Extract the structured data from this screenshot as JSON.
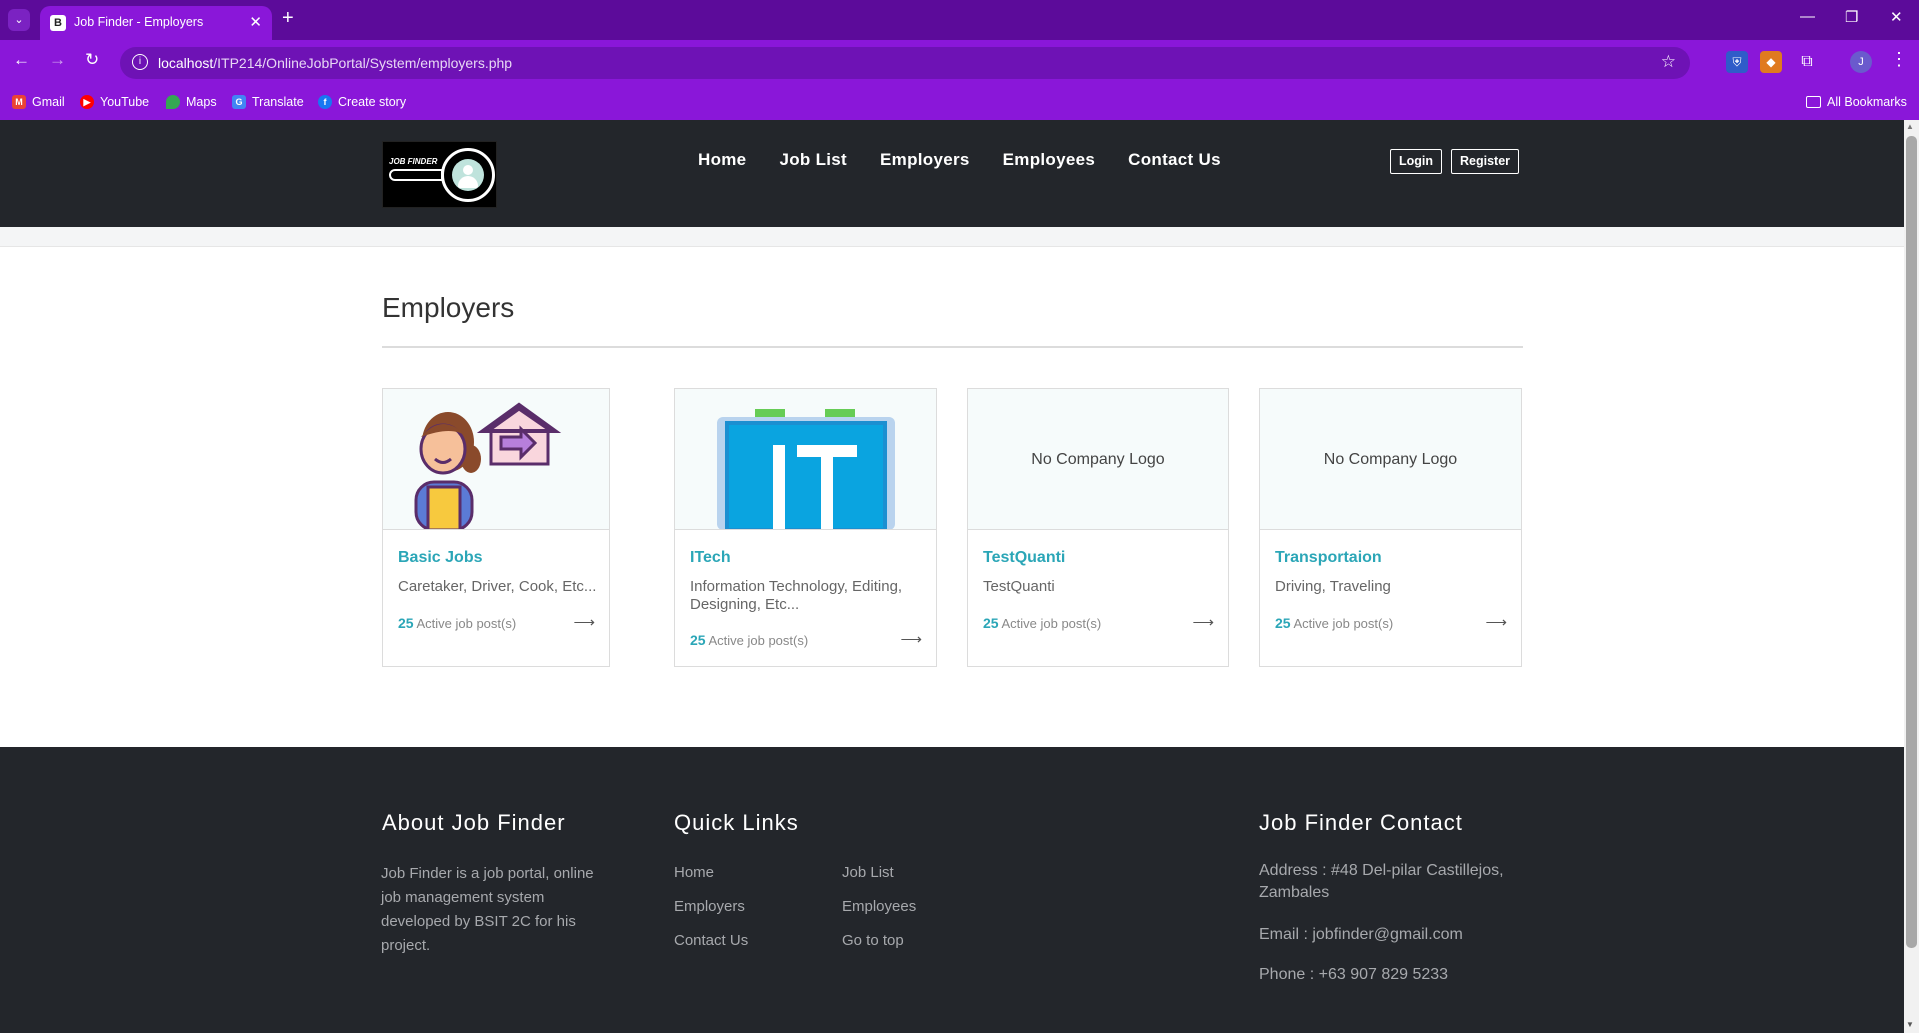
{
  "browser": {
    "tab_title": "Job Finder - Employers",
    "tab_favicon": "B",
    "url_host": "localhost",
    "url_path": "/ITP214/OnlineJobPortal/System/employers.php",
    "profile_initial": "J",
    "bookmarks": [
      "Gmail",
      "YouTube",
      "Maps",
      "Translate",
      "Create story"
    ],
    "all_bookmarks": "All Bookmarks"
  },
  "header": {
    "logo_text": "JOB FINDER",
    "nav": [
      "Home",
      "Job List",
      "Employers",
      "Employees",
      "Contact Us"
    ],
    "login": "Login",
    "register": "Register"
  },
  "page": {
    "title": "Employers"
  },
  "employers": [
    {
      "name": "Basic Jobs",
      "tags": "Caretaker, Driver, Cook, Etc...",
      "count": "25",
      "count_label": "Active job post(s)",
      "logo": "basic-jobs-illustration"
    },
    {
      "name": "ITech",
      "tags": "Information Technology, Editing, Designing, Etc...",
      "count": "25",
      "count_label": "Active job post(s)",
      "logo": "it-folder-illustration"
    },
    {
      "name": "TestQuanti",
      "tags": "TestQuanti",
      "count": "25",
      "count_label": "Active job post(s)",
      "logo_text": "No Company Logo"
    },
    {
      "name": "Transportaion",
      "tags": "Driving, Traveling",
      "count": "25",
      "count_label": "Active job post(s)",
      "logo_text": "No Company Logo"
    }
  ],
  "footer": {
    "about_title": "About Job Finder",
    "about_text": "Job Finder is a job portal, online job management system developed by BSIT 2C for his project.",
    "links_title": "Quick Links",
    "links": [
      "Home",
      "Job List",
      "Employers",
      "Employees",
      "Contact Us",
      "Go to top"
    ],
    "contact_title": "Job Finder Contact",
    "address": "Address : #48 Del-pilar Castillejos, Zambales",
    "email": "Email : jobfinder@gmail.com",
    "phone": "Phone : +63 907 829 5233"
  },
  "colors": {
    "chrome": "#8a17d9",
    "header_bg": "#23262b",
    "accent": "#2ba6b7"
  }
}
